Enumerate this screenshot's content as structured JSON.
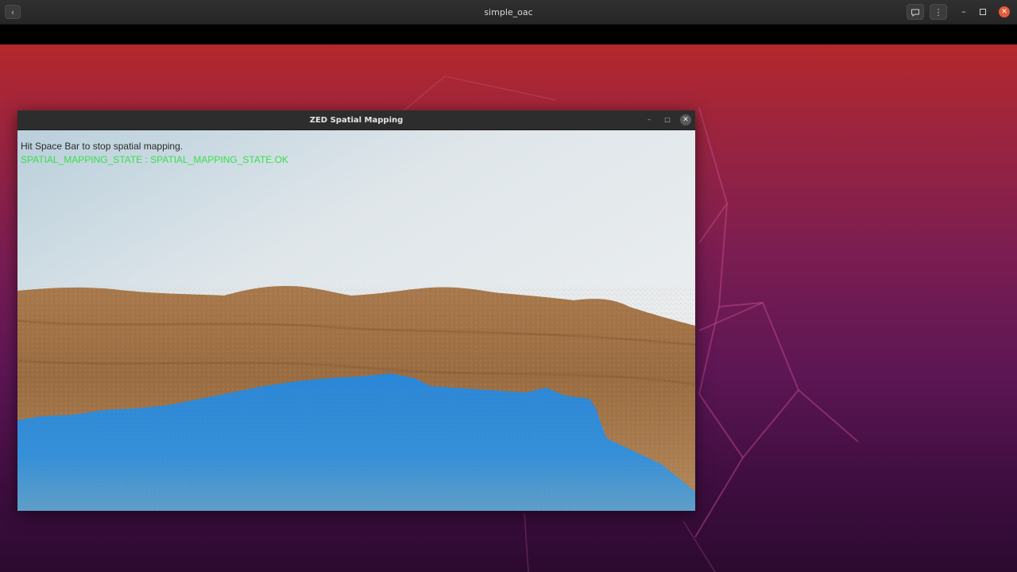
{
  "outer_window": {
    "title": "simple_oac",
    "back_icon": "chevron-left-icon",
    "buttons": [
      {
        "name": "chat",
        "icon": "chat-bubble-icon"
      },
      {
        "name": "menu",
        "icon": "vertical-ellipsis-icon"
      },
      {
        "name": "minimize",
        "icon": "minimize-icon"
      },
      {
        "name": "maximize",
        "icon": "maximize-icon"
      },
      {
        "name": "close",
        "icon": "close-icon"
      }
    ]
  },
  "zed_window": {
    "title": "ZED Spatial Mapping",
    "overlay": {
      "instruction": "Hit Space Bar to stop spatial mapping.",
      "state": "SPATIAL_MAPPING_STATE : SPATIAL_MAPPING_STATE.OK"
    }
  },
  "colors": {
    "state_text": "#36e04a",
    "mesh_blue": "#2f8bd8",
    "terrain": "#a9784a",
    "sky": "#e8ecef",
    "close_button": "#e25c3b"
  }
}
